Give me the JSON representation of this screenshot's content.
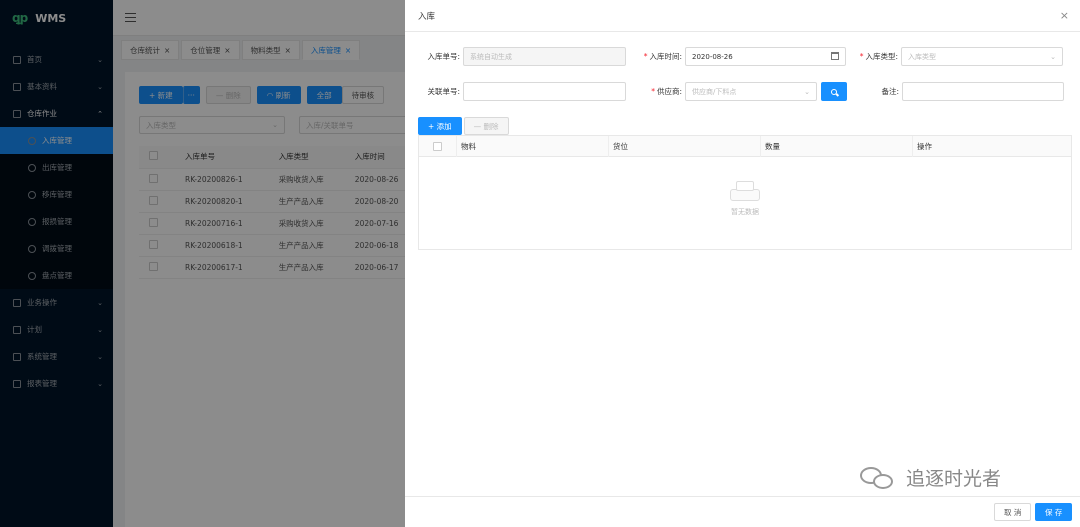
{
  "app": {
    "logo_mark": "ꝗp",
    "name": "WMS"
  },
  "sidebar": {
    "items": [
      {
        "label": "首页",
        "arrow": "⌄"
      },
      {
        "label": "基本资料",
        "arrow": "⌄"
      },
      {
        "label": "仓库作业",
        "arrow": "⌃"
      },
      {
        "label": "业务操作",
        "arrow": "⌄"
      },
      {
        "label": "计划",
        "arrow": "⌄"
      },
      {
        "label": "系统管理",
        "arrow": "⌄"
      },
      {
        "label": "报表管理",
        "arrow": "⌄"
      }
    ],
    "sub_items": [
      {
        "label": "入库管理"
      },
      {
        "label": "出库管理"
      },
      {
        "label": "移库管理"
      },
      {
        "label": "报损管理"
      },
      {
        "label": "调拨管理"
      },
      {
        "label": "盘点管理"
      }
    ]
  },
  "tabs": [
    {
      "label": "仓库统计",
      "close": "×"
    },
    {
      "label": "仓位管理",
      "close": "×"
    },
    {
      "label": "物料类型",
      "close": "×"
    },
    {
      "label": "入库管理",
      "close": "×"
    }
  ],
  "toolbar": {
    "new_label": "+ 新建",
    "more_label": "···",
    "delete_label": "— 删除",
    "refresh_label": "◠ 刷新",
    "all_label": "全部",
    "pending_label": "待审核"
  },
  "filters": {
    "type_placeholder": "入库类型",
    "ref_placeholder": "入库/关联单号"
  },
  "list": {
    "headers": [
      "入库单号",
      "入库类型",
      "入库时间"
    ],
    "rows": [
      [
        "RK-20200826-1",
        "采购收货入库",
        "2020-08-26"
      ],
      [
        "RK-20200820-1",
        "生产产品入库",
        "2020-08-20"
      ],
      [
        "RK-20200716-1",
        "采购收货入库",
        "2020-07-16"
      ],
      [
        "RK-20200618-1",
        "生产产品入库",
        "2020-06-18"
      ],
      [
        "RK-20200617-1",
        "生产产品入库",
        "2020-06-17"
      ]
    ]
  },
  "drawer": {
    "title": "入库",
    "close": "×",
    "fields": {
      "order_no_label": "入库单号:",
      "order_no_value": "系统自动生成",
      "time_label": "入库时间:",
      "time_value": "2020-08-26",
      "type_label": "入库类型:",
      "type_placeholder": "入库类型",
      "ref_label": "关联单号:",
      "ref_value": "",
      "supplier_label": "供应商:",
      "supplier_placeholder": "供应商/下料点",
      "remark_label": "备注:",
      "remark_value": "",
      "required_mark": "*"
    },
    "add_label": "+ 添加",
    "delete_label": "— 删除",
    "table_headers": [
      "物料",
      "货位",
      "数量",
      "操作"
    ],
    "empty_text": "暂无数据",
    "cancel_label": "取 消",
    "save_label": "保 存"
  },
  "watermark": {
    "text": "追逐时光者"
  },
  "colors": {
    "primary": "#1890ff",
    "sidebar_bg": "#001529",
    "required": "#f5222d"
  }
}
